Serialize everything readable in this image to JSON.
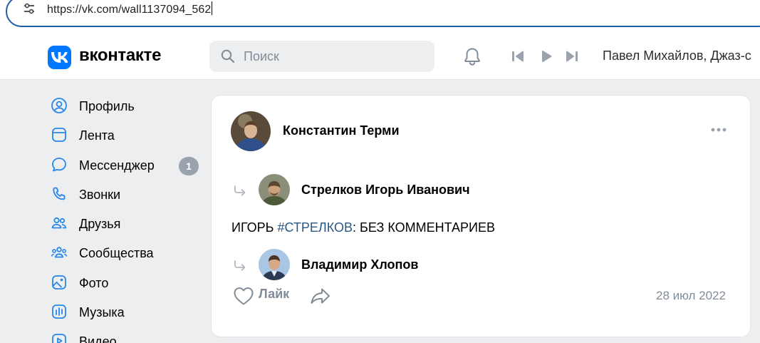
{
  "browser": {
    "url": "https://vk.com/wall1137094_562"
  },
  "header": {
    "logo_text": "вконтакте",
    "search_placeholder": "Поиск",
    "player_track": "Павел Михайлов, Джаз-с"
  },
  "sidebar": {
    "items": [
      {
        "label": "Профиль",
        "icon": "user-circle-icon"
      },
      {
        "label": "Лента",
        "icon": "feed-icon"
      },
      {
        "label": "Мессенджер",
        "icon": "chat-bubble-icon",
        "badge": "1"
      },
      {
        "label": "Звонки",
        "icon": "phone-icon"
      },
      {
        "label": "Друзья",
        "icon": "friends-icon"
      },
      {
        "label": "Сообщества",
        "icon": "communities-icon"
      },
      {
        "label": "Фото",
        "icon": "photo-icon"
      },
      {
        "label": "Музыка",
        "icon": "music-icon"
      },
      {
        "label": "Видео",
        "icon": "video-icon"
      }
    ]
  },
  "post": {
    "author": "Константин Терми",
    "reposts": [
      {
        "name": "Стрелков Игорь Иванович"
      },
      {
        "name": "Владимир Хлопов"
      }
    ],
    "text_before": "ИГОРЬ ",
    "hashtag": "#СТРЕЛКОВ",
    "text_after": ": БЕЗ КОММЕНТАРИЕВ",
    "like_label": "Лайк",
    "date": "28 июл 2022"
  },
  "colors": {
    "brand": "#0077ff",
    "hashtag": "#2a5885",
    "secondary_text": "#818c99",
    "page_background": "#edeef0"
  }
}
